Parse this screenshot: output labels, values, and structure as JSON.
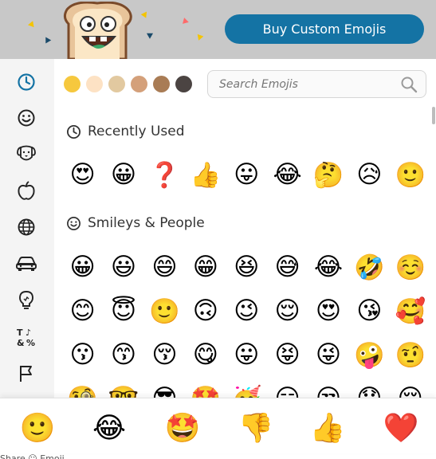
{
  "header": {
    "buy_button_label": "Buy Custom Emojis",
    "accent": "#1473a4"
  },
  "sidebar": {
    "items": [
      {
        "name": "recent",
        "icon": "clock-icon"
      },
      {
        "name": "smileys",
        "icon": "smiley-icon"
      },
      {
        "name": "animals",
        "icon": "dog-icon"
      },
      {
        "name": "food",
        "icon": "apple-icon"
      },
      {
        "name": "travel",
        "icon": "globe-icon"
      },
      {
        "name": "objects",
        "icon": "car-icon"
      },
      {
        "name": "ideas",
        "icon": "lightbulb-icon"
      },
      {
        "name": "symbols",
        "icon": "symbols-icon"
      },
      {
        "name": "flags",
        "icon": "flag-icon"
      }
    ]
  },
  "skin_tones": [
    "#f6c83e",
    "#fde2c4",
    "#e2c9a0",
    "#d4a07a",
    "#a97c55",
    "#4b4442"
  ],
  "search": {
    "placeholder": "Search Emojis"
  },
  "sections": {
    "recent_title": "Recently Used",
    "smileys_title": "Smileys & People"
  },
  "recent_emojis": [
    "😍",
    "😀",
    "❓",
    "👍",
    "😛",
    "😂",
    "🤔",
    "😥",
    "🙂"
  ],
  "smiley_rows": [
    [
      "😀",
      "😃",
      "😄",
      "😁",
      "😆",
      "😅",
      "😂",
      "🤣",
      "☺️"
    ],
    [
      "😊",
      "😇",
      "🙂",
      "🙃",
      "😉",
      "😌",
      "😍",
      "😘",
      "🥰"
    ],
    [
      "😗",
      "😙",
      "😚",
      "😋",
      "😛",
      "😝",
      "😜",
      "🤪",
      "🤨"
    ],
    [
      "🧐",
      "🤓",
      "😎",
      "🤩",
      "🥳",
      "😏",
      "😒",
      "😞",
      "😔"
    ]
  ],
  "bottom_bar": [
    "🙂",
    "😂",
    "🤩",
    "👎",
    "👍",
    "❤️"
  ],
  "behind_text": "Share     ☺       Emoji"
}
